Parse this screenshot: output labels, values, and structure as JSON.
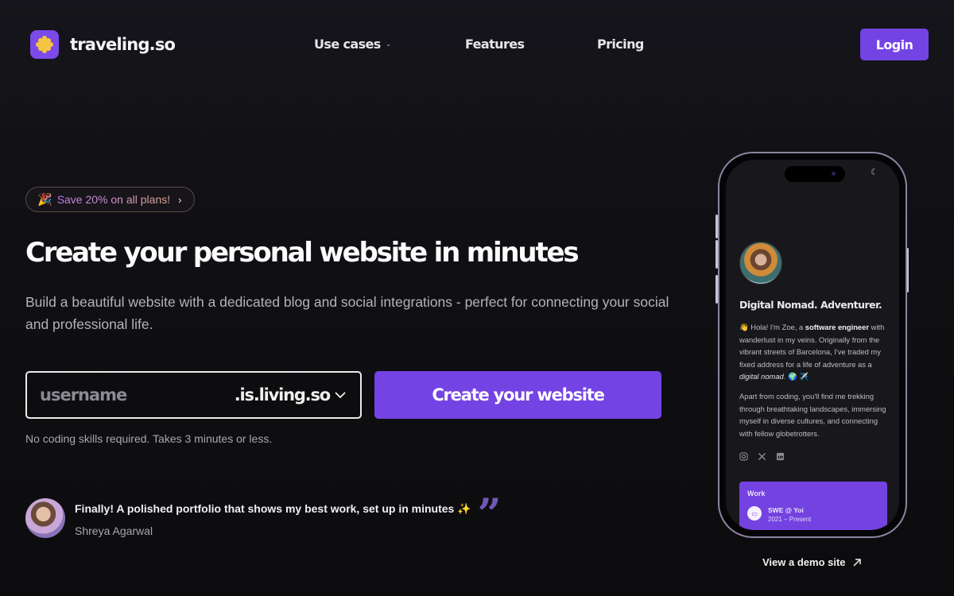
{
  "header": {
    "brand": "traveling.so",
    "logo_icon": "flower-icon",
    "nav": [
      {
        "label": "Use cases",
        "has_dropdown": true
      },
      {
        "label": "Features",
        "has_dropdown": false
      },
      {
        "label": "Pricing",
        "has_dropdown": false
      }
    ],
    "login_label": "Login"
  },
  "hero": {
    "promo": {
      "emoji": "🎉",
      "text": "Save 20% on all plans!",
      "arrow": "›"
    },
    "headline": "Create your personal website in minutes",
    "subtext": "Build a beautiful website with a dedicated blog and social integrations - perfect for connecting your social and professional life.",
    "form": {
      "username_placeholder": "username",
      "username_value": "",
      "domain_selected": ".is.living.so",
      "cta_label": "Create your website",
      "note": "No coding skills required. Takes 3 minutes or less."
    },
    "testimonial": {
      "quote": "Finally! A polished portfolio that shows my best work, set up in minutes ✨",
      "author": "Shreya Agarwal",
      "quote_mark": "❞"
    }
  },
  "phone_preview": {
    "title": "Digital Nomad. Adventurer.",
    "bio_wave": "👋",
    "bio_p1_a": " Hola! I'm Zoe, a ",
    "bio_p1_bold": "software engineer",
    "bio_p1_b": " with wanderlust in my veins. Originally from the vibrant streets of Barcelona, I've traded my fixed address for a life of adventure as a ",
    "bio_p1_italic": "digital nomad",
    "bio_p1_end": ". 🌍 ✈️",
    "bio_p2": "Apart from coding, you'll find me trekking through breathtaking landscapes, immersing myself in diverse cultures, and connecting with fellow globetrotters.",
    "socials": [
      "instagram-icon",
      "x-icon",
      "linkedin-icon"
    ],
    "work": {
      "section_title": "Work",
      "role": "SWE @ Yoi",
      "date": "2021 – Present"
    }
  },
  "demo_link": {
    "label": "View a demo site",
    "icon": "arrow-up-right-icon"
  },
  "colors": {
    "accent": "#7443e4",
    "background": "#0c0c0e",
    "logo_flower": "#f5c542"
  }
}
